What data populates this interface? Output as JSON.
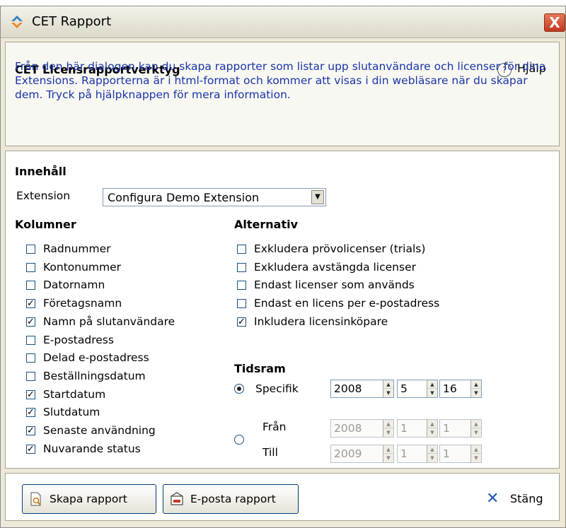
{
  "window": {
    "title": "CET Rapport",
    "close_label": "X"
  },
  "header": {
    "title": "CET Licensrapportverktyg",
    "help_label": "Hjälp",
    "help_icon": "?",
    "description": "Från den här dialogen kan du skapa rapporter som listar upp slutanvändare och licenser för dina Extensions. Rapporterna är i html-format och kommer att visas i din webläsare när du skapar dem. Tryck på hjälpknappen för mera information."
  },
  "content": {
    "section_title": "Innehåll",
    "extension_label": "Extension",
    "extension_value": "Configura Demo Extension"
  },
  "columns": {
    "title": "Kolumner",
    "items": [
      {
        "label": "Radnummer",
        "checked": false
      },
      {
        "label": "Kontonummer",
        "checked": false
      },
      {
        "label": "Datornamn",
        "checked": false
      },
      {
        "label": "Företagsnamn",
        "checked": true
      },
      {
        "label": "Namn på slutanvändare",
        "checked": true
      },
      {
        "label": "E-postadress",
        "checked": false
      },
      {
        "label": "Delad e-postadress",
        "checked": false
      },
      {
        "label": "Beställningsdatum",
        "checked": false
      },
      {
        "label": "Startdatum",
        "checked": true
      },
      {
        "label": "Slutdatum",
        "checked": true
      },
      {
        "label": "Senaste användning",
        "checked": true
      },
      {
        "label": "Nuvarande status",
        "checked": true
      }
    ]
  },
  "options": {
    "title": "Alternativ",
    "items": [
      {
        "label": "Exkludera prövolicenser (trials)",
        "checked": false
      },
      {
        "label": "Exkludera avstängda licenser",
        "checked": false
      },
      {
        "label": "Endast licenser som används",
        "checked": false
      },
      {
        "label": "Endast en licens per e-postadress",
        "checked": false
      },
      {
        "label": "Inkludera licensinköpare",
        "checked": true
      }
    ]
  },
  "timeframe": {
    "title": "Tidsram",
    "selected": "specific",
    "specific_label": "Specifik",
    "specific": {
      "year": "2008",
      "month": "5",
      "day": "16"
    },
    "from_label": "Från",
    "from": {
      "year": "2008",
      "month": "1",
      "day": "1"
    },
    "to_label": "Till",
    "to": {
      "year": "2009",
      "month": "1",
      "day": "1"
    }
  },
  "footer": {
    "create_label": "Skapa rapport",
    "email_label": "E-posta rapport",
    "close_label": "Stäng",
    "close_icon": "✕"
  },
  "colors": {
    "description_text": "#1a34a8",
    "close_button": "#c0381f",
    "close_x": "#1e5bb8"
  }
}
